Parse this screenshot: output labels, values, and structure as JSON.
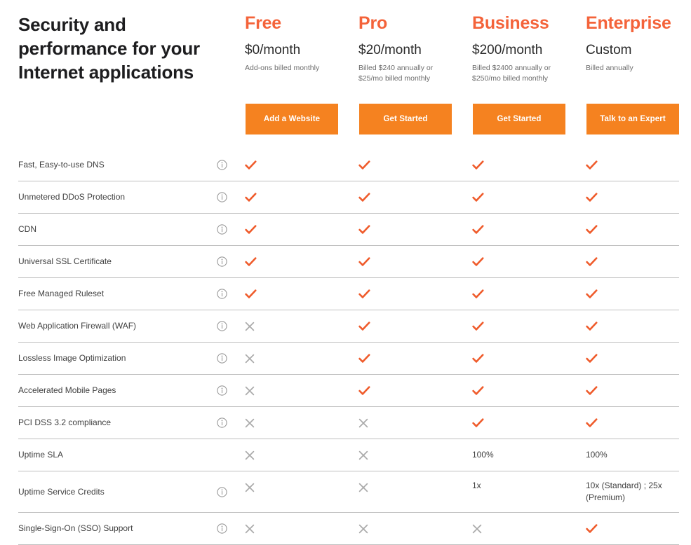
{
  "hero": {
    "title": "Security and performance for your Internet applications"
  },
  "plans": [
    {
      "name": "Free",
      "price": "$0/month",
      "note": "Add-ons billed monthly",
      "cta": "Add a Website"
    },
    {
      "name": "Pro",
      "price": "$20/month",
      "note": "Billed $240 annually or $25/mo billed monthly",
      "cta": "Get Started"
    },
    {
      "name": "Business",
      "price": "$200/month",
      "note": "Billed $2400 annually or $250/mo billed monthly",
      "cta": "Get Started"
    },
    {
      "name": "Enterprise",
      "price": "Custom",
      "note": "Billed annually",
      "cta": "Talk to an Expert"
    }
  ],
  "colors": {
    "plan_name": "#f4633a",
    "button": "#f58220",
    "check": "#ef5b2b",
    "cross": "#aaaaaa",
    "row_border": "#bfbfbf",
    "heading": "#1d1d1f"
  },
  "icons": {
    "info": "info-circle-icon",
    "check": "checkmark-icon",
    "cross": "cross-icon"
  },
  "features": [
    {
      "label": "Fast, Easy-to-use DNS",
      "info": true,
      "values": [
        "check",
        "check",
        "check",
        "check"
      ]
    },
    {
      "label": "Unmetered DDoS Protection",
      "info": true,
      "values": [
        "check",
        "check",
        "check",
        "check"
      ]
    },
    {
      "label": "CDN",
      "info": true,
      "values": [
        "check",
        "check",
        "check",
        "check"
      ]
    },
    {
      "label": "Universal SSL Certificate",
      "info": true,
      "values": [
        "check",
        "check",
        "check",
        "check"
      ]
    },
    {
      "label": "Free Managed Ruleset",
      "info": true,
      "values": [
        "check",
        "check",
        "check",
        "check"
      ]
    },
    {
      "label": "Web Application Firewall (WAF)",
      "info": true,
      "values": [
        "cross",
        "check",
        "check",
        "check"
      ]
    },
    {
      "label": "Lossless Image Optimization",
      "info": true,
      "values": [
        "cross",
        "check",
        "check",
        "check"
      ]
    },
    {
      "label": "Accelerated Mobile Pages",
      "info": true,
      "values": [
        "cross",
        "check",
        "check",
        "check"
      ]
    },
    {
      "label": "PCI DSS 3.2 compliance",
      "info": true,
      "values": [
        "cross",
        "cross",
        "check",
        "check"
      ]
    },
    {
      "label": "Uptime SLA",
      "info": false,
      "values": [
        "cross",
        "cross",
        "100%",
        "100%"
      ]
    },
    {
      "label": "Uptime Service Credits",
      "info": true,
      "tall": true,
      "values": [
        "cross",
        "cross",
        "1x",
        "10x (Standard) ; 25x (Premium)"
      ]
    },
    {
      "label": "Single-Sign-On (SSO) Support",
      "info": true,
      "values": [
        "cross",
        "cross",
        "cross",
        "check"
      ]
    }
  ]
}
